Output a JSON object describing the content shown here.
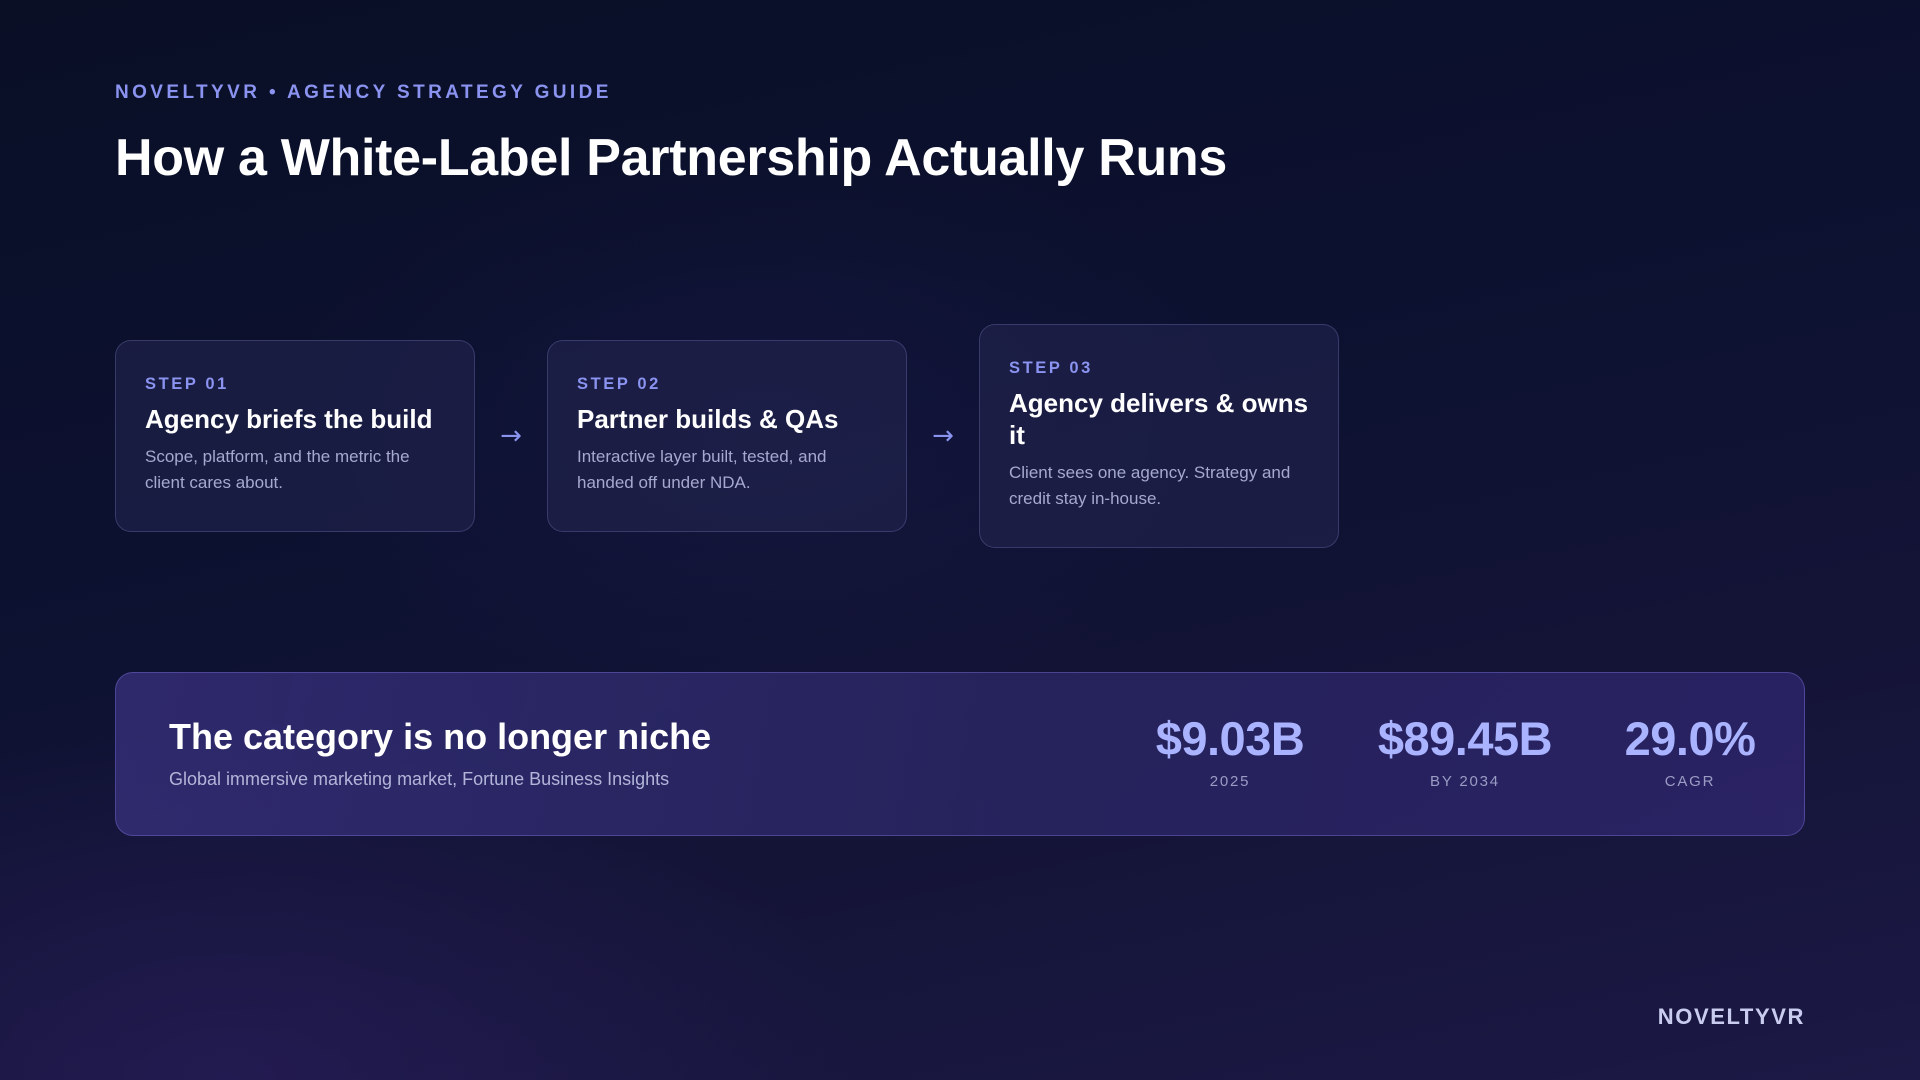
{
  "header": {
    "eyebrow": "NOVELTYVR • AGENCY STRATEGY GUIDE",
    "title": "How a White-Label Partnership Actually Runs"
  },
  "steps": [
    {
      "label": "STEP 01",
      "title": "Agency briefs the build",
      "description": "Scope, platform, and the metric the client cares about."
    },
    {
      "label": "STEP 02",
      "title": "Partner builds & QAs",
      "description": "Interactive layer built, tested, and handed off under NDA."
    },
    {
      "label": "STEP 03",
      "title": "Agency delivers & owns it",
      "description": "Client sees one agency. Strategy and credit stay in-house."
    }
  ],
  "arrows": [
    "→",
    "→"
  ],
  "stats_band": {
    "title": "The category is no longer niche",
    "subtitle": "Global immersive marketing market, Fortune Business Insights",
    "stats": [
      {
        "value": "$9.03B",
        "label": "2025"
      },
      {
        "value": "$89.45B",
        "label": "BY 2034"
      },
      {
        "value": "29.0%",
        "label": "CAGR"
      }
    ]
  },
  "footer": {
    "brand": "NOVELTYVR"
  },
  "colors": {
    "accent": "#8a93f0",
    "stat_value": "#a9b3ff",
    "background": "#0c1130"
  }
}
